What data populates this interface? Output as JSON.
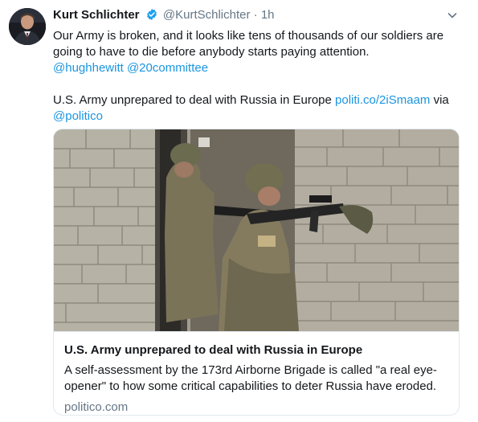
{
  "tweet": {
    "author_name": "Kurt Schlichter",
    "handle": "@KurtSchlichter",
    "separator": "·",
    "time": "1h",
    "text_line": "Our Army is broken, and it looks like tens of thousands of our soldiers are going to have to die before anybody starts paying attention.",
    "mentions": [
      "@hughhewitt",
      "@20committee"
    ],
    "headline_text": "U.S. Army unprepared to deal with Russia in Europe",
    "short_link": "politi.co/2iSmaam",
    "via_word": "via",
    "via_account": "@politico"
  },
  "card": {
    "title": "U.S. Army unprepared to deal with Russia in Europe",
    "description": "A self-assessment by the 173rd Airborne Brigade is called \"a real eye-opener\" to how some critical capabilities to deter Russia have eroded.",
    "domain": "politico.com"
  },
  "colors": {
    "link": "#1b95e0",
    "secondary_text": "#657786",
    "verified_badge": "#1da1f2",
    "card_border": "#e1e8ed"
  },
  "icons": {
    "verified": "verified-badge-icon",
    "caret": "chevron-down-icon"
  }
}
